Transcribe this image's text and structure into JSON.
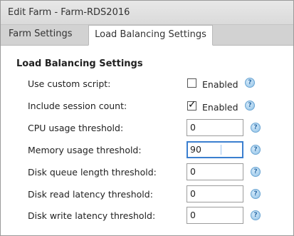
{
  "window": {
    "title": "Edit Farm - Farm-RDS2016"
  },
  "tabs": [
    {
      "label": "Farm Settings",
      "active": false
    },
    {
      "label": "Load Balancing Settings",
      "active": true
    }
  ],
  "section": {
    "heading": "Load Balancing Settings"
  },
  "fields": {
    "use_custom_script": {
      "label": "Use custom script:",
      "checked": false,
      "option_label": "Enabled"
    },
    "include_session_count": {
      "label": "Include session count:",
      "checked": true,
      "option_label": "Enabled"
    },
    "cpu_usage_threshold": {
      "label": "CPU usage threshold:",
      "value": "0"
    },
    "memory_usage_threshold": {
      "label": "Memory usage threshold:",
      "value": "90"
    },
    "disk_queue_length_threshold": {
      "label": "Disk queue length threshold:",
      "value": "0"
    },
    "disk_read_latency_threshold": {
      "label": "Disk read latency threshold:",
      "value": "0"
    },
    "disk_write_latency_threshold": {
      "label": "Disk write latency threshold:",
      "value": "0"
    }
  },
  "help_icon_glyph": "?",
  "check_glyph": "✓",
  "colors": {
    "focus_border": "#3b7fcf",
    "help_icon": "#8fc1e6"
  }
}
